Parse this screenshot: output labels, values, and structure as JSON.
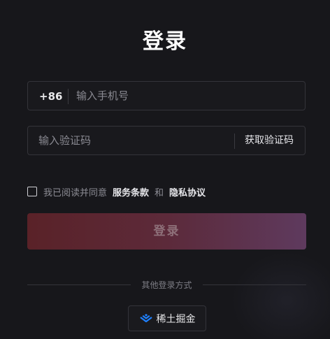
{
  "page": {
    "title": "登录"
  },
  "phone": {
    "country_code": "+86",
    "placeholder": "输入手机号"
  },
  "code": {
    "placeholder": "输入验证码",
    "get_code_label": "获取验证码"
  },
  "agreement": {
    "prefix": "我已阅读并同意",
    "terms_label": "服务条款",
    "conjunction": "和",
    "privacy_label": "隐私协议"
  },
  "login_button": {
    "label": "登录"
  },
  "other_login": {
    "label": "其他登录方式",
    "provider_label": "稀土掘金",
    "provider_icon": "juejin-logo-icon",
    "provider_color": "#1e80ff"
  },
  "colors": {
    "background": "#17171b",
    "button_gradient_start": "#5a2228",
    "button_gradient_end": "#5e3a5e"
  }
}
